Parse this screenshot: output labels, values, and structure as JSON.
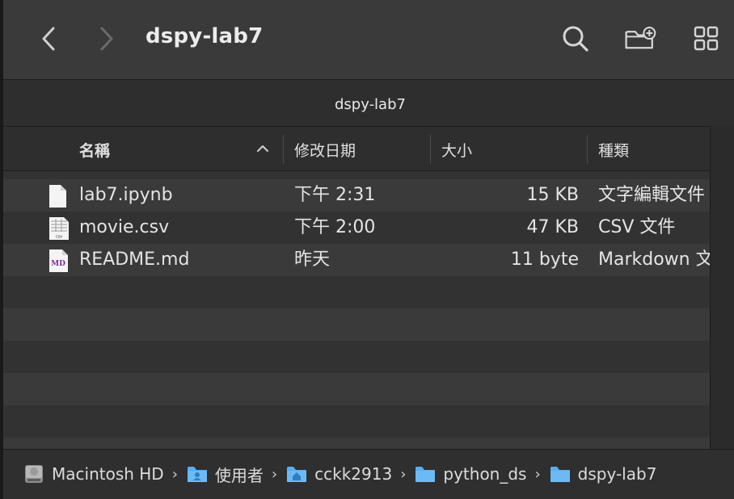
{
  "window": {
    "title": "dspy-lab7"
  },
  "tab": {
    "title": "dspy-lab7"
  },
  "columns": {
    "name": "名稱",
    "date": "修改日期",
    "size": "大小",
    "kind": "種類"
  },
  "files": [
    {
      "name": "lab7.ipynb",
      "date": "下午 2:31",
      "size": "15 KB",
      "kind": "文字編輯文件",
      "icon": "document-icon"
    },
    {
      "name": "movie.csv",
      "date": "下午 2:00",
      "size": "47 KB",
      "kind": "CSV 文件",
      "icon": "csv-file-icon"
    },
    {
      "name": "README.md",
      "date": "昨天",
      "size": "11 byte",
      "kind": "Markdown 文件",
      "icon": "markdown-file-icon"
    }
  ],
  "path": [
    {
      "label": "Macintosh HD",
      "icon": "hard-drive-icon"
    },
    {
      "label": "使用者",
      "icon": "users-folder-icon"
    },
    {
      "label": "cckk2913",
      "icon": "home-folder-icon"
    },
    {
      "label": "python_ds",
      "icon": "folder-icon"
    },
    {
      "label": "dspy-lab7",
      "icon": "folder-icon"
    }
  ],
  "colors": {
    "accent_folder": "#5aaef0",
    "window_bg": "#323232",
    "row_alt": "#3a3a3a"
  }
}
